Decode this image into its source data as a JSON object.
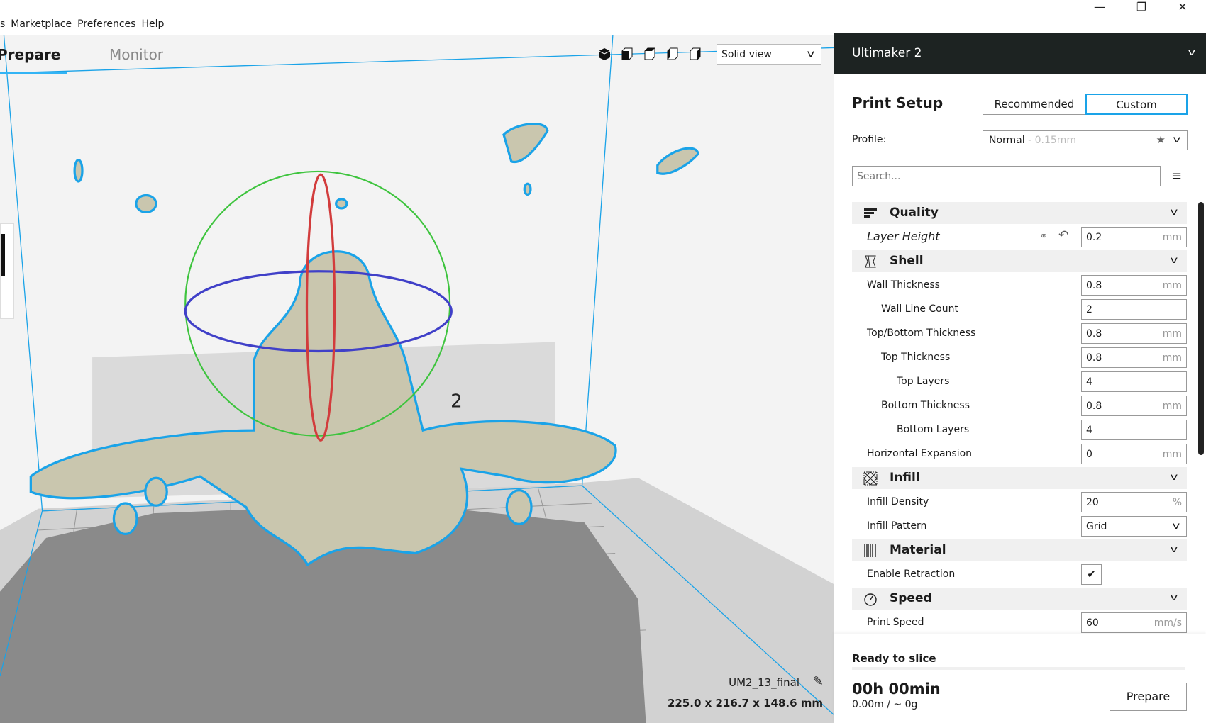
{
  "window_controls": {
    "minimize": "—",
    "maximize": "❐",
    "close": "✕"
  },
  "menu": [
    "s",
    "Marketplace",
    "Preferences",
    "Help"
  ],
  "tabs": {
    "prepare": "Prepare",
    "monitor": "Monitor"
  },
  "view_mode": {
    "selected": "Solid view"
  },
  "view_icons": [
    "3d-view-icon",
    "front-view-icon",
    "top-view-icon",
    "left-view-icon",
    "right-view-icon"
  ],
  "scene": {
    "badge": "2",
    "model_name": "UM2_13_final",
    "dimensions": "225.0 x 216.7 x 148.6 mm"
  },
  "colors": {
    "accent": "#1aa3e8",
    "header_bg": "#1d2322",
    "gizmo_x": "#d23c3c",
    "gizmo_y": "#3ec43e",
    "gizmo_z": "#4040c8"
  },
  "panel": {
    "printer": "Ultimaker 2",
    "title": "Print Setup",
    "mode_recommended": "Recommended",
    "mode_custom": "Custom",
    "active_mode": "Custom",
    "profile_label": "Profile:",
    "profile_value": "Normal",
    "profile_hint": "- 0.15mm",
    "search_placeholder": "Search..."
  },
  "settings": [
    {
      "type": "category",
      "label": "Quality",
      "icon": "quality-icon"
    },
    {
      "type": "value",
      "label": "Layer Height",
      "value": "0.2",
      "unit": "mm",
      "indent": 1,
      "italic": true,
      "linked": true
    },
    {
      "type": "category",
      "label": "Shell",
      "icon": "shell-icon"
    },
    {
      "type": "value",
      "label": "Wall Thickness",
      "value": "0.8",
      "unit": "mm",
      "indent": 1
    },
    {
      "type": "value",
      "label": "Wall Line Count",
      "value": "2",
      "unit": "",
      "indent": 2
    },
    {
      "type": "value",
      "label": "Top/Bottom Thickness",
      "value": "0.8",
      "unit": "mm",
      "indent": 1
    },
    {
      "type": "value",
      "label": "Top Thickness",
      "value": "0.8",
      "unit": "mm",
      "indent": 2
    },
    {
      "type": "value",
      "label": "Top Layers",
      "value": "4",
      "unit": "",
      "indent": 3
    },
    {
      "type": "value",
      "label": "Bottom Thickness",
      "value": "0.8",
      "unit": "mm",
      "indent": 2
    },
    {
      "type": "value",
      "label": "Bottom Layers",
      "value": "4",
      "unit": "",
      "indent": 3
    },
    {
      "type": "value",
      "label": "Horizontal Expansion",
      "value": "0",
      "unit": "mm",
      "indent": 1
    },
    {
      "type": "category",
      "label": "Infill",
      "icon": "infill-icon"
    },
    {
      "type": "value",
      "label": "Infill Density",
      "value": "20",
      "unit": "%",
      "indent": 1
    },
    {
      "type": "select",
      "label": "Infill Pattern",
      "value": "Grid",
      "indent": 1
    },
    {
      "type": "category",
      "label": "Material",
      "icon": "material-icon"
    },
    {
      "type": "checkbox",
      "label": "Enable Retraction",
      "checked": true,
      "indent": 1
    },
    {
      "type": "category",
      "label": "Speed",
      "icon": "speed-icon"
    },
    {
      "type": "value",
      "label": "Print Speed",
      "value": "60",
      "unit": "mm/s",
      "indent": 1
    }
  ],
  "slice": {
    "status": "Ready to slice",
    "time": "00h 00min",
    "material": "0.00m / ~ 0g",
    "button": "Prepare"
  }
}
